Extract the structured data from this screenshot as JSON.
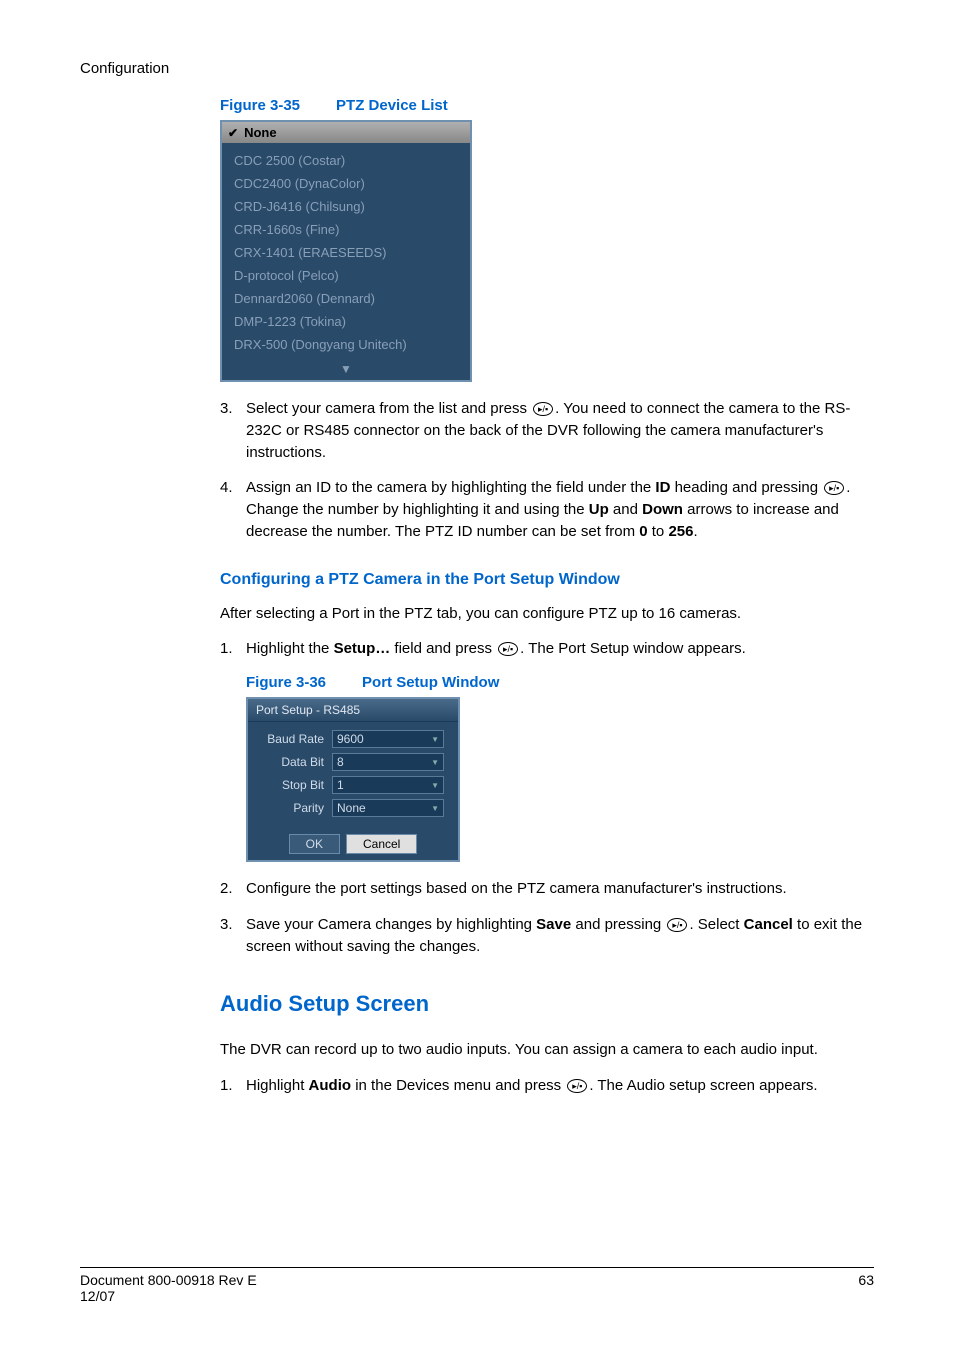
{
  "header": {
    "section": "Configuration"
  },
  "figure35": {
    "label": "Figure 3-35",
    "title": "PTZ Device List",
    "header_item": "None",
    "items": [
      "CDC 2500 (Costar)",
      "CDC2400 (DynaColor)",
      "CRD-J6416 (Chilsung)",
      "CRR-1660s (Fine)",
      "CRX-1401 (ERAESEEDS)",
      "D-protocol (Pelco)",
      "Dennard2060 (Dennard)",
      "DMP-1223 (Tokina)",
      "DRX-500 (Dongyang Unitech)"
    ]
  },
  "step3": {
    "num": "3.",
    "prefix": "Select your camera from the list and press ",
    "suffix": ". You need to connect the camera to the RS-232C or RS485 connector on the back of the DVR following the camera manufacturer's instructions."
  },
  "step4": {
    "num": "4.",
    "p1": "Assign an ID to the camera by highlighting the field under the ",
    "id_bold": "ID",
    "p2": " heading and pressing ",
    "p3": ". Change the number by highlighting it and using the ",
    "up_bold": "Up",
    "and": " and ",
    "down_bold": "Down",
    "p4": " arrows to increase and decrease the number. The PTZ ID number can be set from ",
    "zero": "0",
    "p5": " to ",
    "v256": "256",
    "dot": "."
  },
  "subhead_ptz": "Configuring a PTZ Camera in the Port Setup Window",
  "ptz_intro": "After selecting a Port in the PTZ tab, you can configure PTZ up to 16 cameras.",
  "ptz_step1": {
    "num": "1.",
    "p1": "Highlight the ",
    "setup_bold": "Setup…",
    "p2": " field and press ",
    "p3": ". The Port Setup window appears."
  },
  "figure36": {
    "label": "Figure 3-36",
    "title": "Port Setup Window",
    "window_title": "Port Setup - RS485",
    "rows": {
      "baud": {
        "label": "Baud Rate",
        "value": "9600"
      },
      "databit": {
        "label": "Data Bit",
        "value": "8"
      },
      "stopbit": {
        "label": "Stop Bit",
        "value": "1"
      },
      "parity": {
        "label": "Parity",
        "value": "None"
      }
    },
    "ok": "OK",
    "cancel": "Cancel"
  },
  "ptz_step2": {
    "num": "2.",
    "text": "Configure the port settings based on the PTZ camera manufacturer's instructions."
  },
  "ptz_step3": {
    "num": "3.",
    "p1": "Save your Camera changes by highlighting ",
    "save_bold": "Save",
    "p2": " and pressing ",
    "p3": ". Select ",
    "cancel_bold": "Cancel",
    "p4": " to exit the screen without saving the changes."
  },
  "audio_head": "Audio Setup Screen",
  "audio_intro": "The DVR can record up to two audio inputs. You can assign a camera to each audio input.",
  "audio_step1": {
    "num": "1.",
    "p1": "Highlight ",
    "audio_bold": "Audio",
    "p2": " in the Devices menu and press ",
    "p3": ". The Audio setup screen appears."
  },
  "footer": {
    "doc": "Document 800-00918 Rev E",
    "date": "12/07",
    "page": "63"
  },
  "icon_glyph": "▸/▪"
}
